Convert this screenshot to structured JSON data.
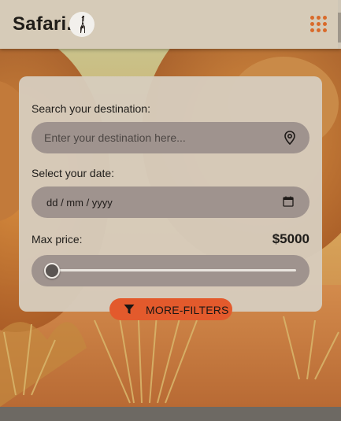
{
  "header": {
    "logo_text": "Safari.",
    "logo_badge_icon": "giraffe-icon",
    "menu_icon": "grid-menu-icon",
    "accent_color": "#d96a2a"
  },
  "search": {
    "destination_label": "Search your destination:",
    "destination_placeholder": "Enter your destination here...",
    "destination_icon": "location-pin-icon",
    "date_label": "Select your date:",
    "date_value": "dd / mm / yyyy",
    "date_icon": "calendar-icon",
    "price_label": "Max price:",
    "price_value": "$5000",
    "price_slider_fraction": 0.0
  },
  "filters_button": {
    "label": "MORE-FILTERS",
    "icon": "filter-funnel-icon",
    "color": "#e35a2c"
  },
  "hero": {
    "image_subject": "lion-background-image"
  }
}
